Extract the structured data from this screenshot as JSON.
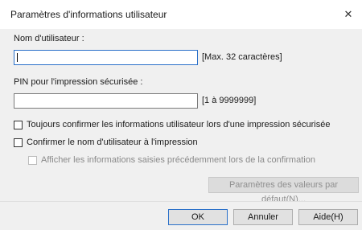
{
  "window": {
    "title": "Paramètres d'informations utilisateur",
    "close_symbol": "✕"
  },
  "form": {
    "username_label": "Nom d'utilisateur :",
    "username_value": "",
    "username_hint": "[Max. 32 caractères]",
    "pin_label": "PIN pour l'impression sécurisée :",
    "pin_value": "",
    "pin_hint": "[1 à 9999999]"
  },
  "options": {
    "always_confirm": {
      "label": "Toujours confirmer les informations utilisateur lors d'une impression sécurisée",
      "checked": false
    },
    "confirm_username": {
      "label": "Confirmer le nom d'utilisateur à l'impression",
      "checked": false
    },
    "show_entered": {
      "label": "Afficher les informations saisies précédemment lors de la confirmation",
      "checked": false,
      "enabled": false
    }
  },
  "buttons": {
    "defaults_label": "Paramètres des valeurs par défaut(N)...",
    "ok_label": "OK",
    "cancel_label": "Annuler",
    "help_label": "Aide(H)"
  }
}
